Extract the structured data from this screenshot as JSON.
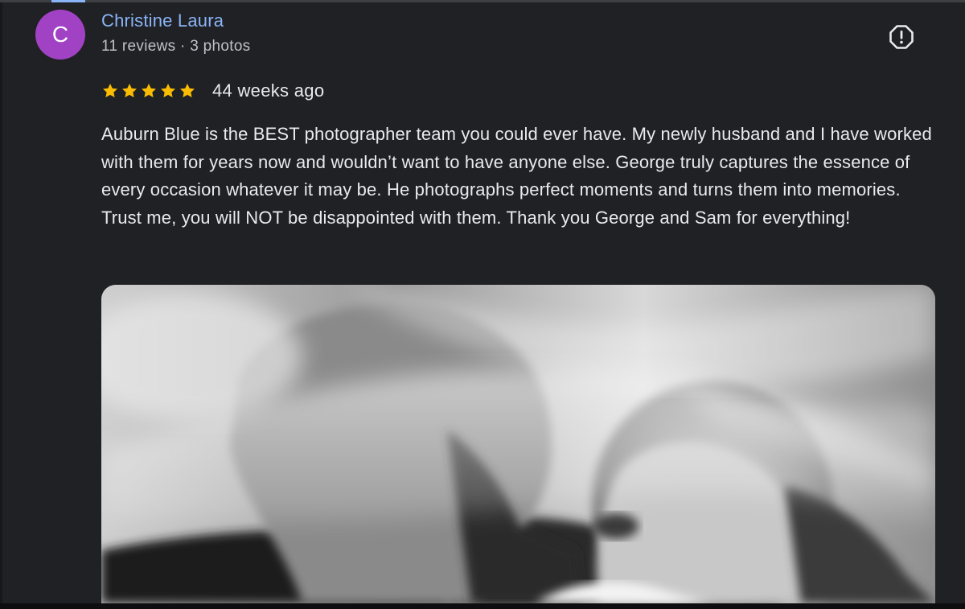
{
  "review": {
    "author": {
      "initial": "C",
      "name": "Christine Laura",
      "meta": "11 reviews · 3 photos",
      "avatar_color": "#a142c4"
    },
    "rating": 5,
    "rating_max": 5,
    "date": "44 weeks ago",
    "text": "Auburn Blue is the BEST photographer team you could ever have. My newly husband and I have worked with them for years now and wouldn’t want to have anyone else. George truly captures the essence of every occasion whatever it may be. He photographs perfect moments and turns them into memories. Trust me, you will NOT be disappointed with them. Thank you George and Sam for everything!",
    "report_icon": "report-flag-octagon-icon",
    "star_color": "#fbbc04",
    "link_color": "#8ab4f8"
  }
}
